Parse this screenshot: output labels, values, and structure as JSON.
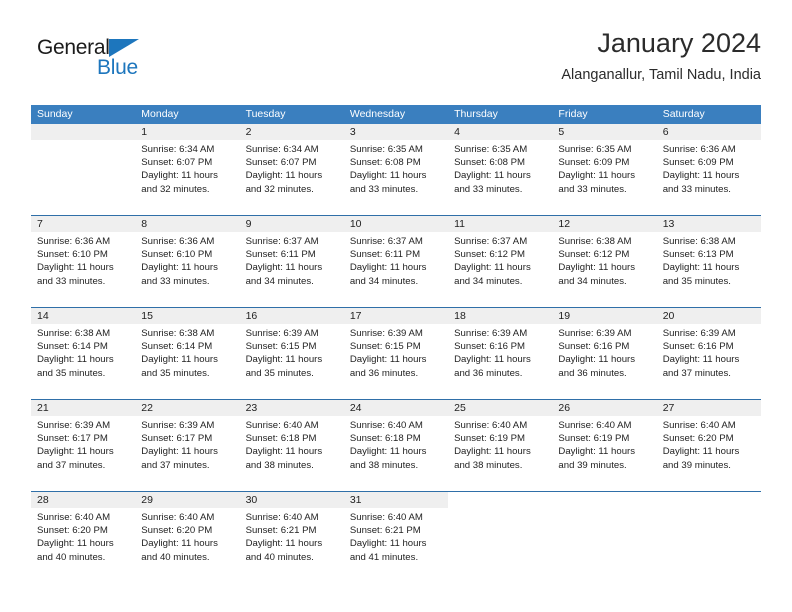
{
  "branding": {
    "logo_text_primary": "General",
    "logo_text_secondary": "Blue",
    "logo_primary_color": "#1b1b1b",
    "logo_accent_color": "#1d76bd"
  },
  "header": {
    "title": "January 2024",
    "subtitle": "Alanganallur, Tamil Nadu, India"
  },
  "theme": {
    "header_blue": "#3a7fbf",
    "separator_blue": "#2f6fa8",
    "daynum_band": "#efefef",
    "text": "#222222"
  },
  "calendar": {
    "weekday_headers": [
      "Sunday",
      "Monday",
      "Tuesday",
      "Wednesday",
      "Thursday",
      "Friday",
      "Saturday"
    ],
    "weeks": [
      [
        {
          "day": "",
          "lines": []
        },
        {
          "day": "1",
          "lines": [
            "Sunrise: 6:34 AM",
            "Sunset: 6:07 PM",
            "Daylight: 11 hours",
            "and 32 minutes."
          ]
        },
        {
          "day": "2",
          "lines": [
            "Sunrise: 6:34 AM",
            "Sunset: 6:07 PM",
            "Daylight: 11 hours",
            "and 32 minutes."
          ]
        },
        {
          "day": "3",
          "lines": [
            "Sunrise: 6:35 AM",
            "Sunset: 6:08 PM",
            "Daylight: 11 hours",
            "and 33 minutes."
          ]
        },
        {
          "day": "4",
          "lines": [
            "Sunrise: 6:35 AM",
            "Sunset: 6:08 PM",
            "Daylight: 11 hours",
            "and 33 minutes."
          ]
        },
        {
          "day": "5",
          "lines": [
            "Sunrise: 6:35 AM",
            "Sunset: 6:09 PM",
            "Daylight: 11 hours",
            "and 33 minutes."
          ]
        },
        {
          "day": "6",
          "lines": [
            "Sunrise: 6:36 AM",
            "Sunset: 6:09 PM",
            "Daylight: 11 hours",
            "and 33 minutes."
          ]
        }
      ],
      [
        {
          "day": "7",
          "lines": [
            "Sunrise: 6:36 AM",
            "Sunset: 6:10 PM",
            "Daylight: 11 hours",
            "and 33 minutes."
          ]
        },
        {
          "day": "8",
          "lines": [
            "Sunrise: 6:36 AM",
            "Sunset: 6:10 PM",
            "Daylight: 11 hours",
            "and 33 minutes."
          ]
        },
        {
          "day": "9",
          "lines": [
            "Sunrise: 6:37 AM",
            "Sunset: 6:11 PM",
            "Daylight: 11 hours",
            "and 34 minutes."
          ]
        },
        {
          "day": "10",
          "lines": [
            "Sunrise: 6:37 AM",
            "Sunset: 6:11 PM",
            "Daylight: 11 hours",
            "and 34 minutes."
          ]
        },
        {
          "day": "11",
          "lines": [
            "Sunrise: 6:37 AM",
            "Sunset: 6:12 PM",
            "Daylight: 11 hours",
            "and 34 minutes."
          ]
        },
        {
          "day": "12",
          "lines": [
            "Sunrise: 6:38 AM",
            "Sunset: 6:12 PM",
            "Daylight: 11 hours",
            "and 34 minutes."
          ]
        },
        {
          "day": "13",
          "lines": [
            "Sunrise: 6:38 AM",
            "Sunset: 6:13 PM",
            "Daylight: 11 hours",
            "and 35 minutes."
          ]
        }
      ],
      [
        {
          "day": "14",
          "lines": [
            "Sunrise: 6:38 AM",
            "Sunset: 6:14 PM",
            "Daylight: 11 hours",
            "and 35 minutes."
          ]
        },
        {
          "day": "15",
          "lines": [
            "Sunrise: 6:38 AM",
            "Sunset: 6:14 PM",
            "Daylight: 11 hours",
            "and 35 minutes."
          ]
        },
        {
          "day": "16",
          "lines": [
            "Sunrise: 6:39 AM",
            "Sunset: 6:15 PM",
            "Daylight: 11 hours",
            "and 35 minutes."
          ]
        },
        {
          "day": "17",
          "lines": [
            "Sunrise: 6:39 AM",
            "Sunset: 6:15 PM",
            "Daylight: 11 hours",
            "and 36 minutes."
          ]
        },
        {
          "day": "18",
          "lines": [
            "Sunrise: 6:39 AM",
            "Sunset: 6:16 PM",
            "Daylight: 11 hours",
            "and 36 minutes."
          ]
        },
        {
          "day": "19",
          "lines": [
            "Sunrise: 6:39 AM",
            "Sunset: 6:16 PM",
            "Daylight: 11 hours",
            "and 36 minutes."
          ]
        },
        {
          "day": "20",
          "lines": [
            "Sunrise: 6:39 AM",
            "Sunset: 6:16 PM",
            "Daylight: 11 hours",
            "and 37 minutes."
          ]
        }
      ],
      [
        {
          "day": "21",
          "lines": [
            "Sunrise: 6:39 AM",
            "Sunset: 6:17 PM",
            "Daylight: 11 hours",
            "and 37 minutes."
          ]
        },
        {
          "day": "22",
          "lines": [
            "Sunrise: 6:39 AM",
            "Sunset: 6:17 PM",
            "Daylight: 11 hours",
            "and 37 minutes."
          ]
        },
        {
          "day": "23",
          "lines": [
            "Sunrise: 6:40 AM",
            "Sunset: 6:18 PM",
            "Daylight: 11 hours",
            "and 38 minutes."
          ]
        },
        {
          "day": "24",
          "lines": [
            "Sunrise: 6:40 AM",
            "Sunset: 6:18 PM",
            "Daylight: 11 hours",
            "and 38 minutes."
          ]
        },
        {
          "day": "25",
          "lines": [
            "Sunrise: 6:40 AM",
            "Sunset: 6:19 PM",
            "Daylight: 11 hours",
            "and 38 minutes."
          ]
        },
        {
          "day": "26",
          "lines": [
            "Sunrise: 6:40 AM",
            "Sunset: 6:19 PM",
            "Daylight: 11 hours",
            "and 39 minutes."
          ]
        },
        {
          "day": "27",
          "lines": [
            "Sunrise: 6:40 AM",
            "Sunset: 6:20 PM",
            "Daylight: 11 hours",
            "and 39 minutes."
          ]
        }
      ],
      [
        {
          "day": "28",
          "lines": [
            "Sunrise: 6:40 AM",
            "Sunset: 6:20 PM",
            "Daylight: 11 hours",
            "and 40 minutes."
          ]
        },
        {
          "day": "29",
          "lines": [
            "Sunrise: 6:40 AM",
            "Sunset: 6:20 PM",
            "Daylight: 11 hours",
            "and 40 minutes."
          ]
        },
        {
          "day": "30",
          "lines": [
            "Sunrise: 6:40 AM",
            "Sunset: 6:21 PM",
            "Daylight: 11 hours",
            "and 40 minutes."
          ]
        },
        {
          "day": "31",
          "lines": [
            "Sunrise: 6:40 AM",
            "Sunset: 6:21 PM",
            "Daylight: 11 hours",
            "and 41 minutes."
          ]
        },
        {
          "day": "",
          "lines": []
        },
        {
          "day": "",
          "lines": []
        },
        {
          "day": "",
          "lines": []
        }
      ]
    ]
  }
}
